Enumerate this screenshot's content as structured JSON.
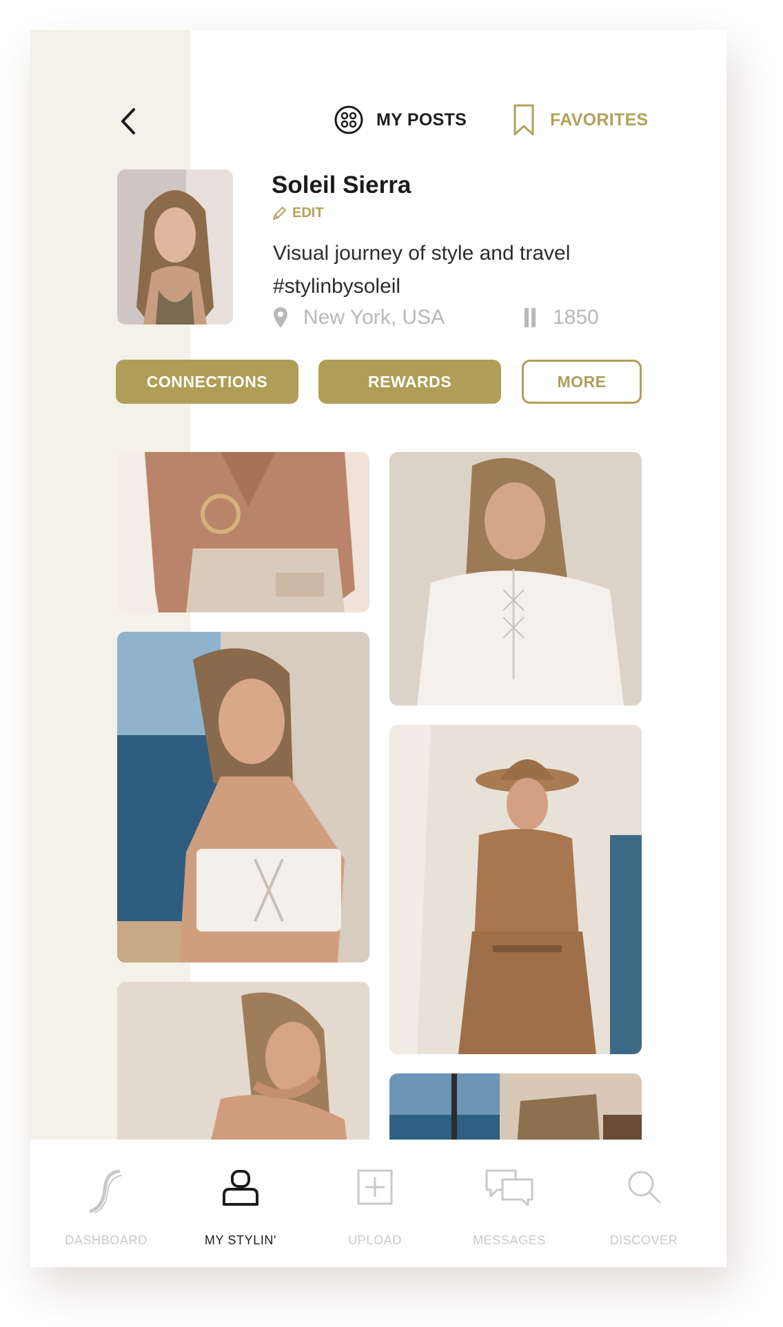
{
  "header": {
    "tabs": [
      {
        "label": "MY POSTS",
        "icon": "grid-circle-icon",
        "active": true
      },
      {
        "label": "FAVORITES",
        "icon": "bookmark-icon",
        "active": false
      }
    ]
  },
  "profile": {
    "name": "Soleil Sierra",
    "edit_label": "EDIT",
    "bio": "Visual journey of style and travel #stylinbysoleil",
    "location": "New York, USA",
    "count": "1850"
  },
  "actions": [
    {
      "label": "CONNECTIONS",
      "style": "filled"
    },
    {
      "label": "REWARDS",
      "style": "filled"
    },
    {
      "label": "MORE",
      "style": "outline"
    }
  ],
  "nav": [
    {
      "label": "DASHBOARD",
      "icon": "stylin-logo-icon",
      "active": false
    },
    {
      "label": "MY STYLIN'",
      "icon": "user-icon",
      "active": true
    },
    {
      "label": "UPLOAD",
      "icon": "plus-square-icon",
      "active": false
    },
    {
      "label": "MESSAGES",
      "icon": "chat-bubbles-icon",
      "active": false
    },
    {
      "label": "DISCOVER",
      "icon": "search-icon",
      "active": false
    }
  ],
  "colors": {
    "accent": "#b09d57",
    "strip": "#f3f1e8",
    "text": "#1b1b1b",
    "muted": "#c9c9c9"
  }
}
